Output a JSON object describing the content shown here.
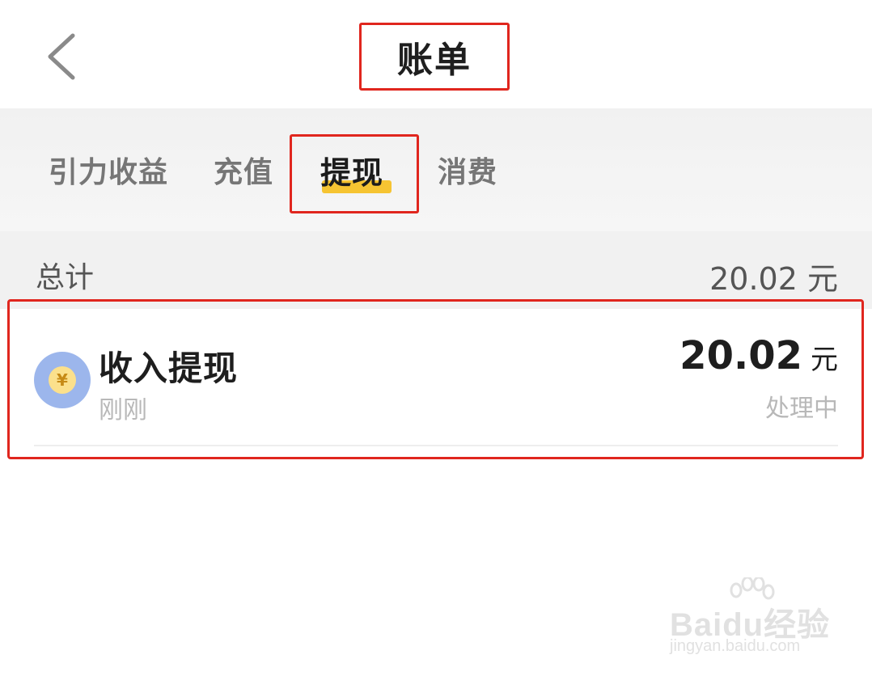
{
  "header": {
    "title": "账单"
  },
  "tabs": [
    {
      "label": "引力收益",
      "active": false
    },
    {
      "label": "充值",
      "active": false
    },
    {
      "label": "提现",
      "active": true
    },
    {
      "label": "消费",
      "active": false
    }
  ],
  "summary": {
    "label": "总计",
    "amount": "20.02 元"
  },
  "records": [
    {
      "icon": "coin-yuan-icon",
      "icon_glyph": "¥",
      "title": "收入提现",
      "time": "刚刚",
      "amount": "20.02",
      "unit": "元",
      "status": "处理中"
    }
  ],
  "watermark": {
    "brand": "Baidu经验",
    "url": "jingyan.baidu.com"
  },
  "colors": {
    "highlight_box": "#e0261e",
    "tab_underline": "#f6c432",
    "coin_bg": "#9cb6ec",
    "coin_inner": "#fbe08c"
  }
}
